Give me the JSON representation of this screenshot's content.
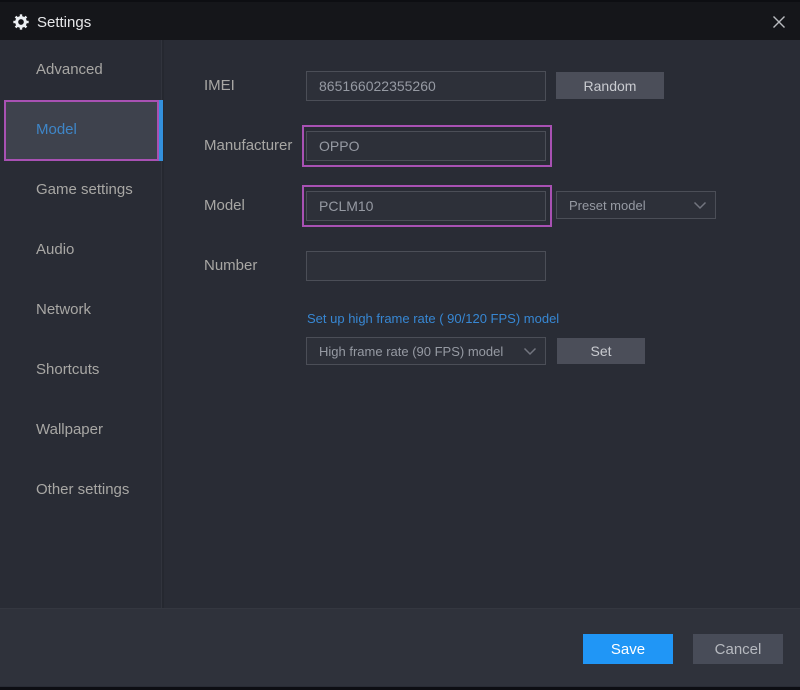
{
  "titlebar": {
    "title": "Settings"
  },
  "sidebar": {
    "items": [
      "Advanced",
      "Model",
      "Game settings",
      "Audio",
      "Network",
      "Shortcuts",
      "Wallpaper",
      "Other settings"
    ],
    "selected": "Model"
  },
  "form": {
    "imei_label": "IMEI",
    "imei_value": "865166022355260",
    "random_button": "Random",
    "manufacturer_label": "Manufacturer",
    "manufacturer_value": "OPPO",
    "model_label": "Model",
    "model_value": "PCLM10",
    "preset_dropdown_value": "Preset model",
    "number_label": "Number",
    "number_value": "",
    "hfr_link": "Set up high frame rate ( 90/120 FPS) model",
    "hfr_dropdown_value": "High frame rate (90 FPS) model",
    "set_button": "Set"
  },
  "footer": {
    "save_button": "Save",
    "cancel_button": "Cancel"
  },
  "colors": {
    "accent_blue": "#2096f6",
    "highlight_magenta": "#a851b3",
    "link_blue": "#3787d3",
    "selected_item_text": "#3e86c8",
    "titlebar_bg": "#15161a",
    "panel_bg": "#292c35",
    "input_bg": "#2d3039"
  }
}
